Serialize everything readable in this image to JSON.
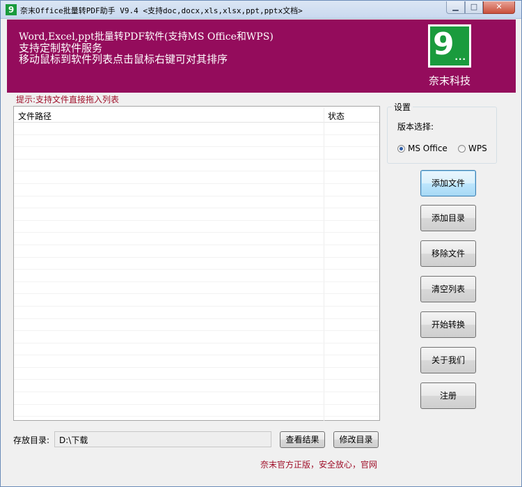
{
  "window": {
    "title": "奈末Office批量转PDF助手 V9.4  <支持doc,docx,xls,xlsx,ppt,pptx文档>",
    "app_icon": "9",
    "minimize_icon": "minimize-icon",
    "maximize_icon": "maximize-icon",
    "close_icon": "close-icon"
  },
  "banner": {
    "line1": "Word,Excel,ppt批量转PDF软件(支持MS Office和WPS)",
    "line2": "支持定制软件服务",
    "line3": "移动鼠标到软件列表点击鼠标右键可对其排序",
    "logo_text": "9",
    "logo_dots": "...",
    "company": "奈末科技",
    "background_color": "#940c5c",
    "logo_color": "#1a9b3d"
  },
  "hint": "提示:支持文件直接拖入列表",
  "file_list": {
    "columns": [
      "文件路径",
      "状态"
    ],
    "rows": []
  },
  "settings": {
    "title": "设置",
    "version_label": "版本选择:",
    "options": [
      {
        "label": "MS Office",
        "checked": true
      },
      {
        "label": "WPS",
        "checked": false
      }
    ]
  },
  "buttons": {
    "add_file": "添加文件",
    "add_dir": "添加目录",
    "remove_file": "移除文件",
    "clear_list": "清空列表",
    "start": "开始转换",
    "about": "关于我们",
    "register": "注册"
  },
  "output": {
    "label": "存放目录:",
    "path": "D:\\下载",
    "view_results": "查看结果",
    "modify_dir": "修改目录"
  },
  "footer": "奈末官方正版，安全放心，官网"
}
